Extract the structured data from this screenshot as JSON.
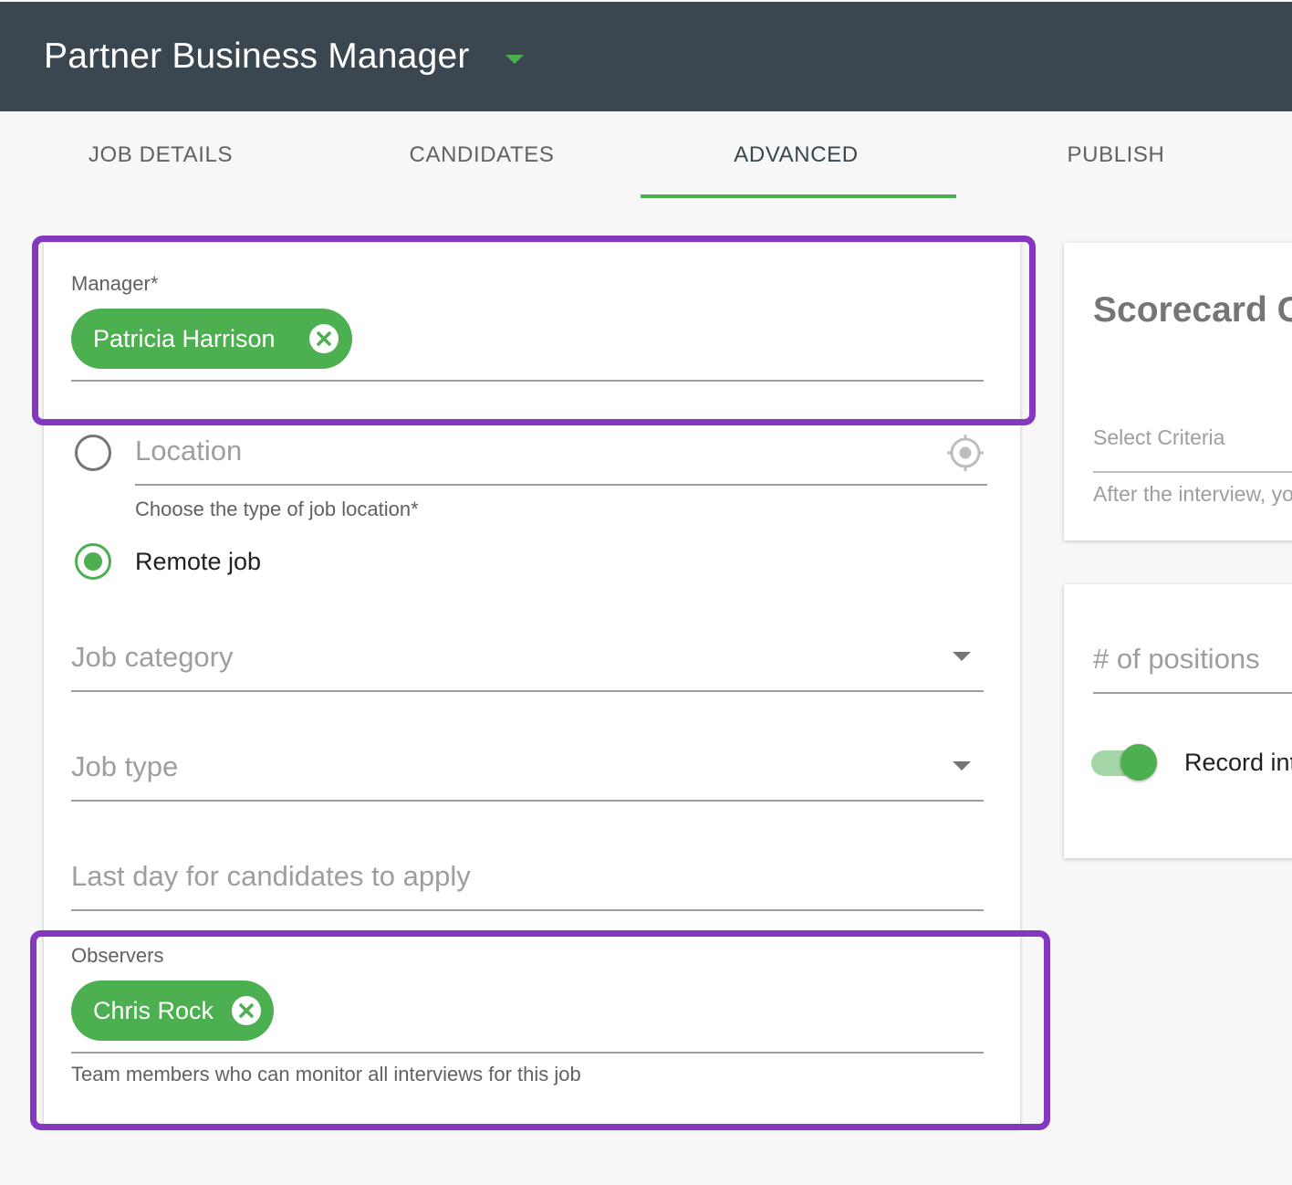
{
  "header": {
    "title": "Partner Business Manager"
  },
  "tabs": [
    {
      "label": "JOB DETAILS",
      "active": false
    },
    {
      "label": "CANDIDATES",
      "active": false
    },
    {
      "label": "ADVANCED",
      "active": true
    },
    {
      "label": "PUBLISH",
      "active": false
    }
  ],
  "colors": {
    "header_bg": "#3a4750",
    "accent": "#4caf50",
    "highlight": "#8438c0"
  },
  "form": {
    "manager": {
      "label": "Manager*",
      "chip": "Patricia Harrison"
    },
    "location": {
      "placeholder": "Location",
      "icon": "crosshair-icon"
    },
    "location_type": {
      "helper": "Choose the type of job location*",
      "remote_label": "Remote job",
      "remote_checked": true
    },
    "job_category": {
      "placeholder": "Job category"
    },
    "job_type": {
      "placeholder": "Job type"
    },
    "last_day": {
      "placeholder": "Last day for candidates to apply"
    },
    "observers": {
      "label": "Observers",
      "chip": "Chris Rock",
      "helper": "Team members who can monitor all interviews for this job"
    }
  },
  "side": {
    "scorecard_title": "Scorecard C",
    "select_criteria": "Select Criteria",
    "criteria_helper": "After the interview, yo",
    "positions_placeholder": "# of positions",
    "record_label": "Record int",
    "record_enabled": true
  }
}
